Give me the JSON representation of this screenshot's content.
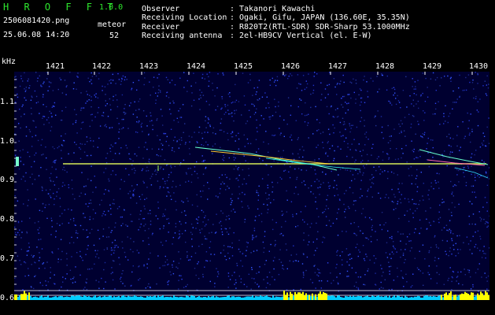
{
  "header": {
    "app_name": "H R O F F T",
    "version": "1.0.0",
    "filename": "2506081420.png",
    "datetime": "25.06.08 14:20",
    "meteor_label": "meteor",
    "meteor_count": "52",
    "info": [
      {
        "label": "Observer",
        "sep": ":",
        "value": "Takanori Kawachi"
      },
      {
        "label": "Receiving Location",
        "sep": ":",
        "value": "Ogaki, Gifu, JAPAN (136.60E, 35.35N)"
      },
      {
        "label": "Receiver",
        "sep": ":",
        "value": "R820T2(RTL-SDR) SDR-Sharp 53.1000MHz"
      },
      {
        "label": "Receiving antenna",
        "sep": ":",
        "value": "2el-HB9CV Vertical (el. E-W)"
      }
    ]
  },
  "chart_data": {
    "type": "heatmap",
    "ylabel": "kHz",
    "x_ticks": [
      "1421",
      "1422",
      "1423",
      "1424",
      "1425",
      "1426",
      "1427",
      "1428",
      "1429",
      "1430"
    ],
    "y_ticks": [
      "1.1",
      "1.0",
      "0.9",
      "0.8",
      "0.7",
      "0.6"
    ],
    "colors": {
      "background": "#000033",
      "noise": "#3344ff",
      "signal": "#ffff00",
      "baseline": "#00ccff"
    }
  }
}
